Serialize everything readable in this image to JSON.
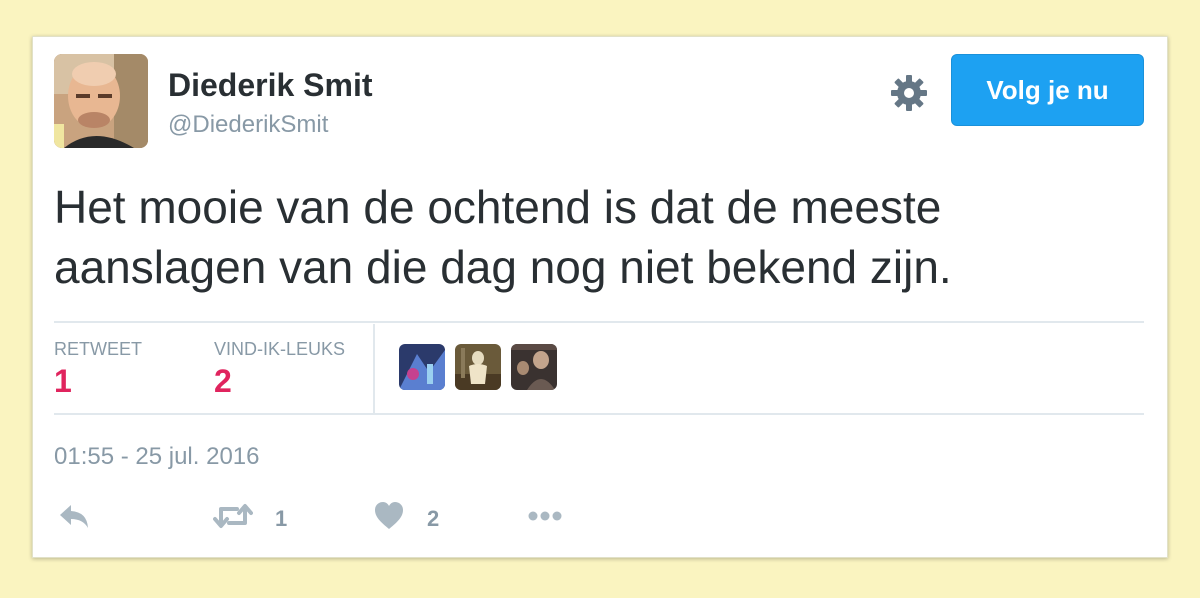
{
  "user": {
    "name": "Diederik Smit",
    "handle": "@DiederikSmit"
  },
  "follow_button": {
    "label": "Volg je nu"
  },
  "tweet": {
    "text_line1": "Het mooie van de ochtend is dat de meeste",
    "text_line2": "aanslagen van die dag nog niet bekend zijn."
  },
  "stats": {
    "retweets_label": "RETWEET",
    "retweets_value": "1",
    "likes_label": "VIND-IK-LEUKS",
    "likes_value": "2"
  },
  "timestamp": "01:55 - 25 jul. 2016",
  "actions": {
    "reply_icon": "reply-icon",
    "retweet_icon": "retweet-icon",
    "retweet_count": "1",
    "like_icon": "heart-icon",
    "like_count": "2",
    "more_icon": "more-icon"
  },
  "colors": {
    "accent": "#1da1f2",
    "like": "#e0245e",
    "muted": "#8899a6",
    "text": "#292f33",
    "page_background": "#faf4c0"
  }
}
